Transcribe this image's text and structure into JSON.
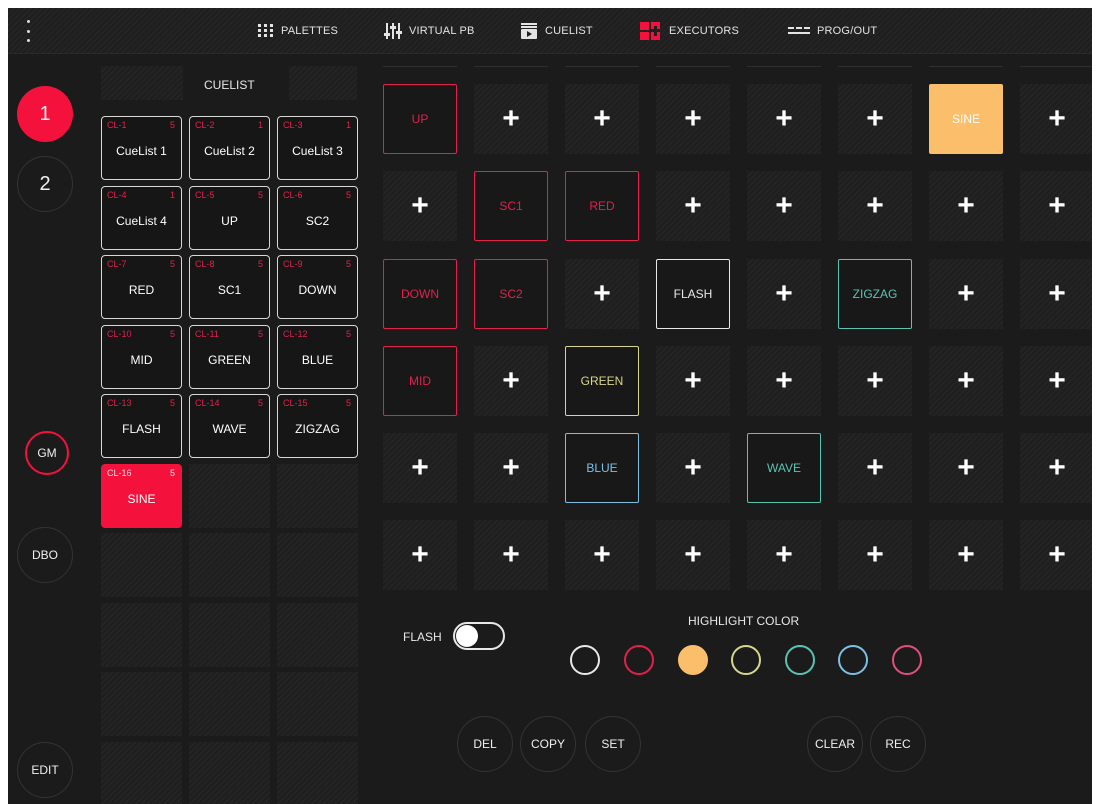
{
  "topbar": {
    "items": [
      {
        "label": "PALETTES",
        "icon": "grid-icon"
      },
      {
        "label": "VIRTUAL PB",
        "icon": "faders-icon"
      },
      {
        "label": "CUELIST",
        "icon": "cuelist-play-icon"
      },
      {
        "label": "EXECUTORS",
        "icon": "executors-icon",
        "active": true
      },
      {
        "label": "PROG/OUT",
        "icon": "lines-icon"
      }
    ],
    "accent": "#f4123d"
  },
  "rail": {
    "page1": "1",
    "page2": "2",
    "gm": "GM",
    "dbo": "DBO",
    "edit": "EDIT"
  },
  "cuelist": {
    "title": "CUELIST",
    "items": [
      {
        "id": "CL-1",
        "count": "5",
        "name": "CueList 1"
      },
      {
        "id": "CL-2",
        "count": "1",
        "name": "CueList 2"
      },
      {
        "id": "CL-3",
        "count": "1",
        "name": "CueList 3"
      },
      {
        "id": "CL-4",
        "count": "1",
        "name": "CueList 4"
      },
      {
        "id": "CL-5",
        "count": "5",
        "name": "UP"
      },
      {
        "id": "CL-6",
        "count": "5",
        "name": "SC2"
      },
      {
        "id": "CL-7",
        "count": "5",
        "name": "RED"
      },
      {
        "id": "CL-8",
        "count": "5",
        "name": "SC1"
      },
      {
        "id": "CL-9",
        "count": "5",
        "name": "DOWN"
      },
      {
        "id": "CL-10",
        "count": "5",
        "name": "MID"
      },
      {
        "id": "CL-11",
        "count": "5",
        "name": "GREEN"
      },
      {
        "id": "CL-12",
        "count": "5",
        "name": "BLUE"
      },
      {
        "id": "CL-13",
        "count": "5",
        "name": "FLASH"
      },
      {
        "id": "CL-14",
        "count": "5",
        "name": "WAVE"
      },
      {
        "id": "CL-15",
        "count": "5",
        "name": "ZIGZAG"
      },
      {
        "id": "CL-16",
        "count": "5",
        "name": "SINE",
        "selected": true
      }
    ]
  },
  "executors": {
    "add_label": "+",
    "assigned": [
      {
        "row": 0,
        "col": 0,
        "label": "UP",
        "color": "#e3204a"
      },
      {
        "row": 0,
        "col": 6,
        "label": "SINE",
        "color": "#fbbf6b",
        "filled": true
      },
      {
        "row": 1,
        "col": 1,
        "label": "SC1",
        "color": "#e3204a"
      },
      {
        "row": 1,
        "col": 2,
        "label": "RED",
        "color": "#e3204a"
      },
      {
        "row": 2,
        "col": 0,
        "label": "DOWN",
        "color": "#e3204a"
      },
      {
        "row": 2,
        "col": 1,
        "label": "SC2",
        "color": "#e3204a"
      },
      {
        "row": 2,
        "col": 3,
        "label": "FLASH",
        "color": "#e8e8e8"
      },
      {
        "row": 2,
        "col": 5,
        "label": "ZIGZAG",
        "color": "#5bc3b2"
      },
      {
        "row": 3,
        "col": 0,
        "label": "MID",
        "color": "#e3204a"
      },
      {
        "row": 3,
        "col": 2,
        "label": "GREEN",
        "color": "#d8d68a"
      },
      {
        "row": 4,
        "col": 2,
        "label": "BLUE",
        "color": "#7cc0e6"
      },
      {
        "row": 4,
        "col": 4,
        "label": "WAVE",
        "color": "#5bc3b2"
      }
    ]
  },
  "controls": {
    "flash_label": "FLASH",
    "flash_on": false,
    "highlight_label": "HIGHLIGHT COLOR",
    "highlight_colors": [
      "#e8e8e8",
      "#e3204a",
      "#fbbf6b",
      "#d8d68a",
      "#5bc3b2",
      "#7cc0e6",
      "#e0507a"
    ],
    "highlight_selected": 2,
    "del": "DEL",
    "copy": "COPY",
    "set": "SET",
    "clear": "CLEAR",
    "rec": "REC"
  }
}
